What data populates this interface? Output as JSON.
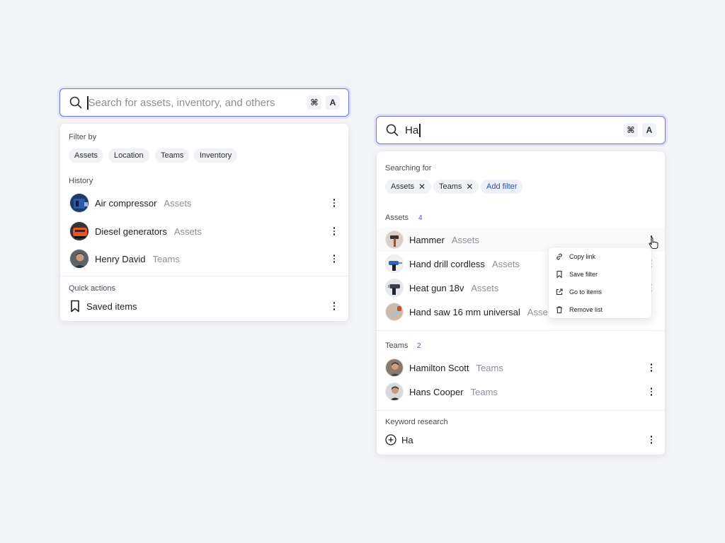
{
  "left": {
    "search": {
      "placeholder": "Search for assets, inventory, and others",
      "shortcut_cmd": "⌘",
      "shortcut_key": "A"
    },
    "filter_label": "Filter by",
    "filters": [
      "Assets",
      "Location",
      "Teams",
      "Inventory"
    ],
    "history_label": "History",
    "history": [
      {
        "name": "Air compressor",
        "category": "Assets",
        "avatar": "compressor-thumbnail"
      },
      {
        "name": "Diesel generators",
        "category": "Assets",
        "avatar": "generator-thumbnail"
      },
      {
        "name": "Henry David",
        "category": "Teams",
        "avatar": "person-avatar"
      }
    ],
    "quick_actions_label": "Quick actions",
    "quick_actions": [
      {
        "label": "Saved items",
        "icon": "bookmark-icon"
      }
    ]
  },
  "right": {
    "search": {
      "value": "Ha",
      "shortcut_cmd": "⌘",
      "shortcut_key": "A"
    },
    "searching_for_label": "Searching for",
    "active_filters": [
      "Assets",
      "Teams"
    ],
    "add_filter_label": "Add filter",
    "assets_label": "Assets",
    "assets_count": "4",
    "assets": [
      {
        "name": "Hammer",
        "category": "Assets"
      },
      {
        "name": "Hand drill cordless",
        "category": "Assets"
      },
      {
        "name": "Heat gun 18v",
        "category": "Assets"
      },
      {
        "name": "Hand saw 16 mm universal",
        "category": "Asse"
      }
    ],
    "teams_label": "Teams",
    "teams_count": "2",
    "teams": [
      {
        "name": "Hamilton Scott",
        "category": "Teams"
      },
      {
        "name": "Hans Cooper",
        "category": "Teams"
      }
    ],
    "keyword_label": "Keyword research",
    "keyword_value": "Ha",
    "context_menu": [
      {
        "label": "Copy link",
        "icon": "link-icon"
      },
      {
        "label": "Save filter",
        "icon": "bookmark-icon"
      },
      {
        "label": "Go to items",
        "icon": "external-link-icon"
      },
      {
        "label": "Remove list",
        "icon": "trash-icon"
      }
    ]
  },
  "colors": {
    "accent": "#6b74e8",
    "link": "#2350c8",
    "muted": "#8c8f98",
    "background": "#f3f4f7"
  }
}
